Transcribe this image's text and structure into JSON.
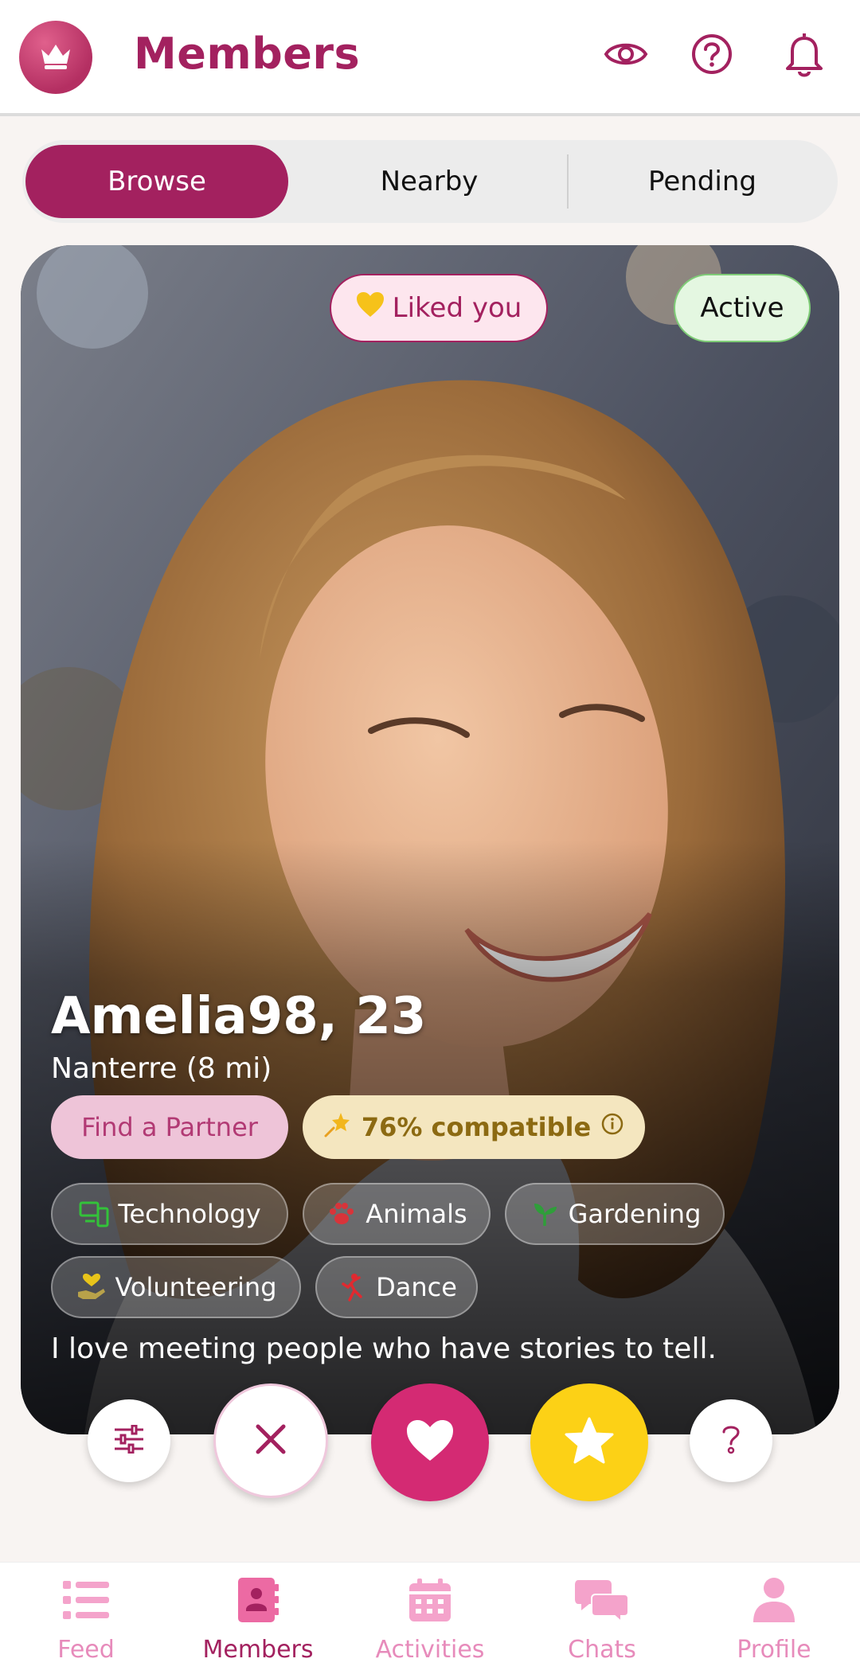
{
  "header": {
    "title": "Members",
    "icons": [
      "crown-icon",
      "eye-icon",
      "help-icon",
      "bell-icon"
    ]
  },
  "tabs": [
    {
      "label": "Browse",
      "active": true
    },
    {
      "label": "Nearby",
      "active": false
    },
    {
      "label": "Pending",
      "active": false
    }
  ],
  "profile": {
    "liked_badge": "Liked you",
    "status_badge": "Active",
    "name_age": "Amelia98, 23",
    "location": "Nanterre (8 mi)",
    "goal": "Find a Partner",
    "compatibility": "76% compatible",
    "interests": [
      {
        "label": "Technology",
        "icon": "devices-icon"
      },
      {
        "label": "Animals",
        "icon": "paw-icon"
      },
      {
        "label": "Gardening",
        "icon": "sprout-icon"
      },
      {
        "label": "Volunteering",
        "icon": "helping-hand-icon"
      },
      {
        "label": "Dance",
        "icon": "dancer-icon"
      }
    ],
    "bio": "I love meeting people who have stories to tell."
  },
  "actions": [
    "filters-icon",
    "close-icon",
    "heart-icon",
    "star-icon",
    "help-icon"
  ],
  "bottom_nav": [
    {
      "label": "Feed",
      "icon": "list-icon",
      "active": false
    },
    {
      "label": "Members",
      "icon": "contacts-book-icon",
      "active": true
    },
    {
      "label": "Activities",
      "icon": "calendar-icon",
      "active": false
    },
    {
      "label": "Chats",
      "icon": "chat-bubbles-icon",
      "active": false
    },
    {
      "label": "Profile",
      "icon": "person-icon",
      "active": false
    }
  ],
  "colors": {
    "brand": "#a3215f",
    "like": "#d42a73",
    "super": "#fcd116",
    "background": "#f8f4f2"
  }
}
